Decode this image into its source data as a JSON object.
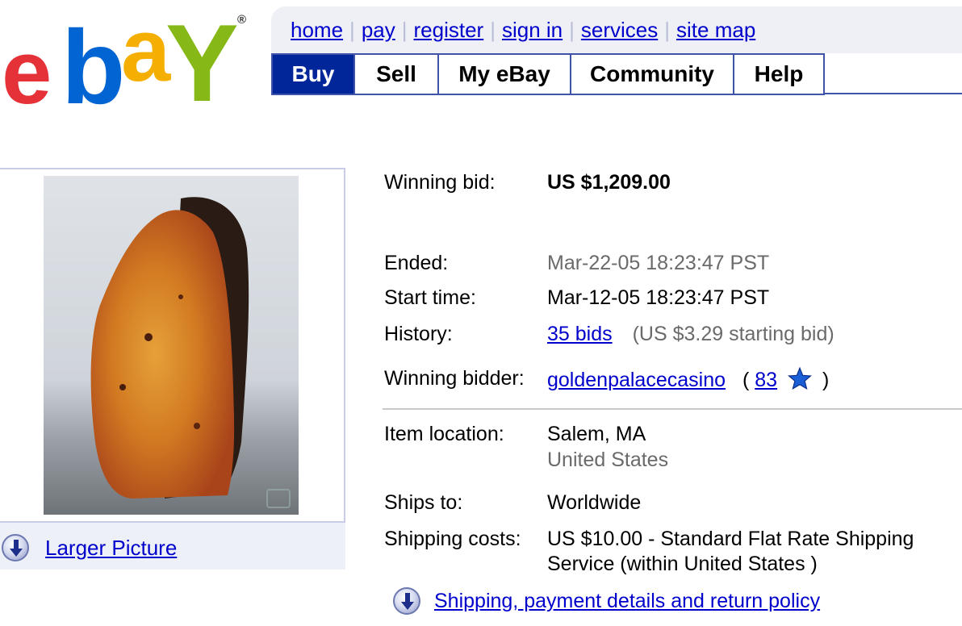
{
  "logo": {
    "e": "e",
    "b": "b",
    "a": "a",
    "y": "Y",
    "reg": "®"
  },
  "toplinks": [
    "home",
    "pay",
    "register",
    "sign in",
    "services",
    "site map"
  ],
  "tabs": [
    "Buy",
    "Sell",
    "My eBay",
    "Community",
    "Help"
  ],
  "active_tab": "Buy",
  "image_panel": {
    "larger_picture_label": "Larger Picture"
  },
  "details": {
    "winning_bid_label": "Winning bid:",
    "winning_bid_value": "US $1,209.00",
    "ended_label": "Ended:",
    "ended_value": "Mar-22-05 18:23:47 PST",
    "start_label": "Start time:",
    "start_value": "Mar-12-05 18:23:47 PST",
    "history_label": "History:",
    "history_bids": "35 bids",
    "history_note": "(US $3.29 starting bid)",
    "winner_label": "Winning bidder:",
    "winner_name": "goldenpalacecasino",
    "winner_paren_open": "(",
    "winner_score": "83",
    "winner_paren_close": ")",
    "location_label": "Item location:",
    "location_city": "Salem, MA",
    "location_country": "United States",
    "ships_label": "Ships to:",
    "ships_value": "Worldwide",
    "shipping_label": "Shipping costs:",
    "shipping_line1": "US $10.00 -  Standard Flat Rate Shipping",
    "shipping_line2": "Service (within United States )",
    "policy_link": "Shipping, payment details and return policy"
  },
  "colors": {
    "link": "#0000cc",
    "tab_active_bg": "#00269a",
    "tab_border": "#3f53a8",
    "star": "#1a5fd6"
  },
  "icons": [
    "down-arrow-circle-icon",
    "star-icon",
    "camera-icon"
  ]
}
